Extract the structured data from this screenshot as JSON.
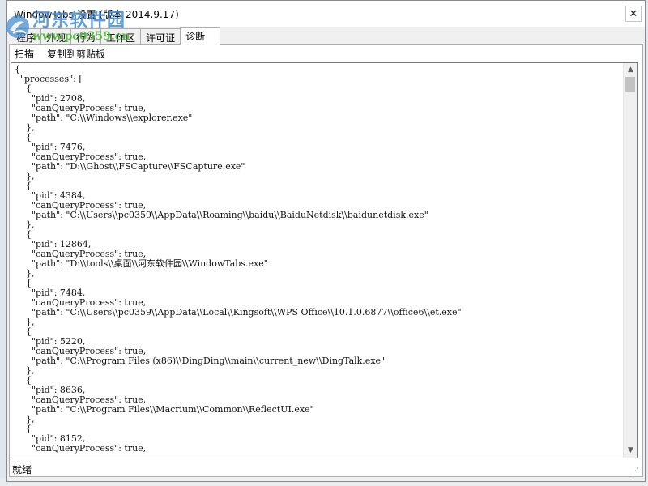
{
  "window": {
    "title": "WindowTabs 设置 (版本 2014.9.17)",
    "close_label": "✕"
  },
  "watermark": {
    "name": "河东软件园",
    "url": "www.pc0359.cn"
  },
  "tabs": [
    {
      "label": "程序"
    },
    {
      "label": "外观"
    },
    {
      "label": "行为"
    },
    {
      "label": "工作区"
    },
    {
      "label": "许可证"
    },
    {
      "label": "诊断",
      "active": true
    }
  ],
  "toolbar": {
    "scan_label": "扫描",
    "copy_label": "复制到剪贴板"
  },
  "diagnostics": {
    "text": "{\n  \"processes\": [\n    {\n      \"pid\": 2708,\n      \"canQueryProcess\": true,\n      \"path\": \"C:\\\\Windows\\\\explorer.exe\"\n    },\n    {\n      \"pid\": 7476,\n      \"canQueryProcess\": true,\n      \"path\": \"D:\\\\Ghost\\\\FSCapture\\\\FSCapture.exe\"\n    },\n    {\n      \"pid\": 4384,\n      \"canQueryProcess\": true,\n      \"path\": \"C:\\\\Users\\\\pc0359\\\\AppData\\\\Roaming\\\\baidu\\\\BaiduNetdisk\\\\baidunetdisk.exe\"\n    },\n    {\n      \"pid\": 12864,\n      \"canQueryProcess\": true,\n      \"path\": \"D:\\\\tools\\\\桌面\\\\河东软件园\\\\WindowTabs.exe\"\n    },\n    {\n      \"pid\": 7484,\n      \"canQueryProcess\": true,\n      \"path\": \"C:\\\\Users\\\\pc0359\\\\AppData\\\\Local\\\\Kingsoft\\\\WPS Office\\\\10.1.0.6877\\\\office6\\\\et.exe\"\n    },\n    {\n      \"pid\": 5220,\n      \"canQueryProcess\": true,\n      \"path\": \"C:\\\\Program Files (x86)\\\\DingDing\\\\main\\\\current_new\\\\DingTalk.exe\"\n    },\n    {\n      \"pid\": 8636,\n      \"canQueryProcess\": true,\n      \"path\": \"C:\\\\Program Files\\\\Macrium\\\\Common\\\\ReflectUI.exe\"\n    },\n    {\n      \"pid\": 8152,\n      \"canQueryProcess\": true,"
  },
  "status": {
    "text": "就绪"
  },
  "icons": {
    "close": "close-icon",
    "scroll_up": "chevron-up-icon",
    "scroll_down": "chevron-down-icon",
    "resize": "resize-grip-icon",
    "watermark_logo": "watermark-logo-icon"
  },
  "colors": {
    "titlebar": "#ffffff",
    "panel": "#ffffff",
    "chrome": "#f0f0f0",
    "watermark_name": "#468cd2",
    "watermark_url": "#50b43c"
  }
}
